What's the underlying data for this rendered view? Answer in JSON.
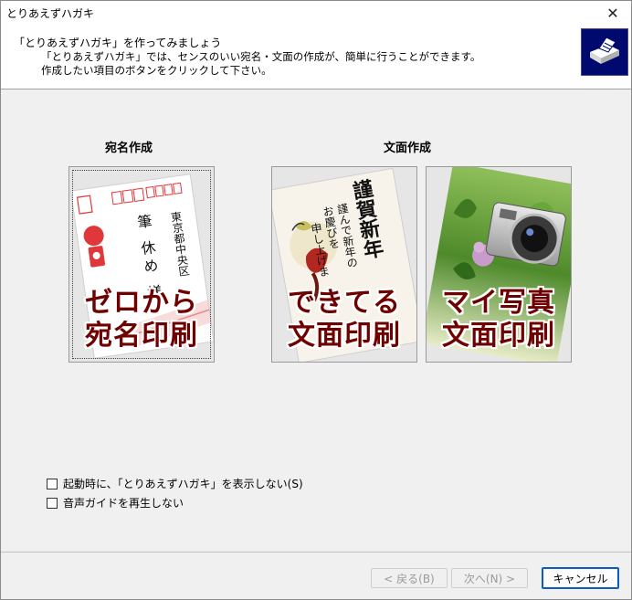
{
  "window": {
    "title": "とりあえずハガキ",
    "close_glyph": "✕"
  },
  "header": {
    "title": "「とりあえずハガキ」を作ってみましょう",
    "desc1": "「とりあえずハガキ」では、センスのいい宛名・文面の作成が、簡単に行うことができます。",
    "desc2": "作成したい項目のボタンをクリックして下さい。"
  },
  "sections": {
    "address": "宛名作成",
    "text": "文面作成"
  },
  "cards": [
    {
      "line1": "ゼロから",
      "line2": "宛名印刷",
      "art": {
        "name": "筆 休め 様",
        "address": "東京都中央区"
      }
    },
    {
      "line1": "できてる",
      "line2": "文面印刷",
      "art": {
        "heading": "謹賀新年",
        "line_a": "謹んで新年の",
        "line_b": "お慶びを",
        "line_c": "申し上げま"
      }
    },
    {
      "line1": "マイ写真",
      "line2": "文面印刷"
    }
  ],
  "options": [
    {
      "label": "起動時に、「とりあえずハガキ」を表示しない(S)",
      "checked": false
    },
    {
      "label": "音声ガイドを再生しない",
      "checked": false
    }
  ],
  "buttons": {
    "back": "< 戻る(B)",
    "next": "次へ(N) >",
    "cancel": "キャンセル"
  },
  "colors": {
    "caption": "#6f0000",
    "logo_bg": "#000a6e",
    "accent": "#0a5cc4"
  }
}
